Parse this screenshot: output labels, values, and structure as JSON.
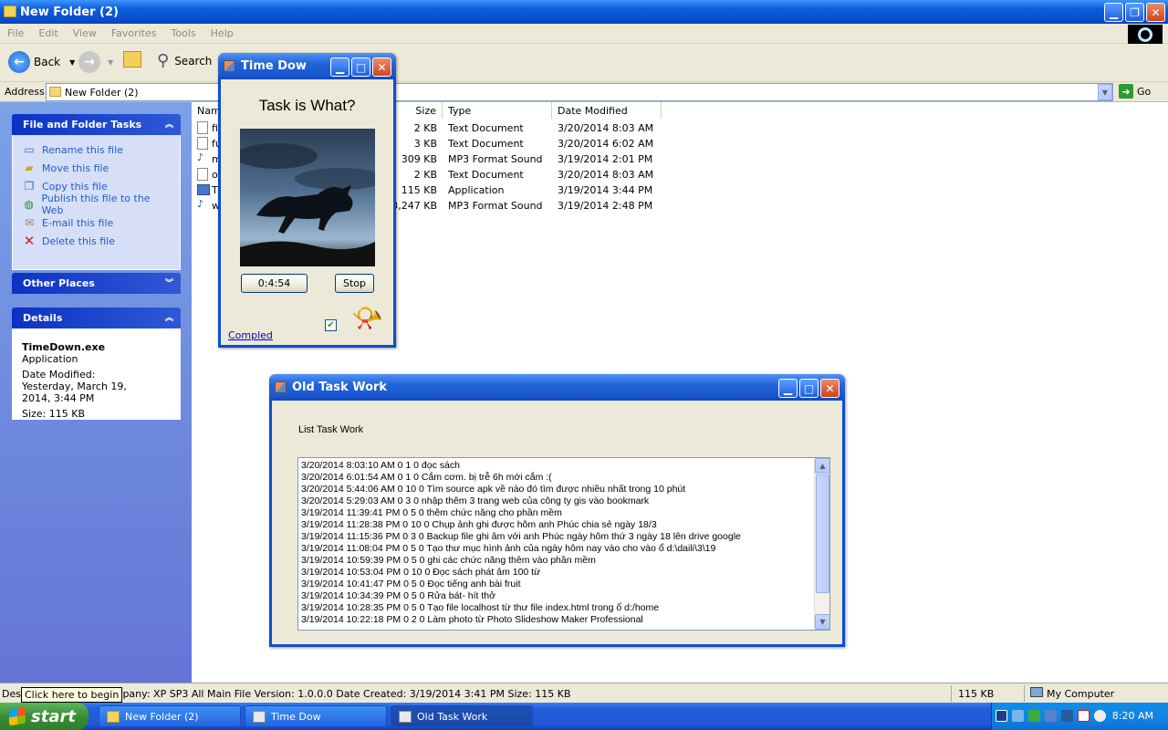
{
  "window": {
    "title": "New Folder (2)",
    "menu": [
      "File",
      "Edit",
      "View",
      "Favorites",
      "Tools",
      "Help"
    ],
    "toolbar": {
      "back_label": "Back",
      "search_label": "Search"
    },
    "address": {
      "label": "Address",
      "value": "New Folder (2)",
      "go_label": "Go"
    }
  },
  "leftpane": {
    "file_tasks": {
      "title": "File and Folder Tasks",
      "items": [
        {
          "label": "Rename this file",
          "icon": "rename-icon"
        },
        {
          "label": "Move this file",
          "icon": "move-icon"
        },
        {
          "label": "Copy this file",
          "icon": "copy-icon"
        },
        {
          "label": "Publish this file to the Web",
          "icon": "publish-icon"
        },
        {
          "label": "E-mail this file",
          "icon": "email-icon"
        },
        {
          "label": "Delete this file",
          "icon": "delete-icon"
        }
      ]
    },
    "other_places": {
      "title": "Other Places"
    },
    "details": {
      "title": "Details",
      "filename": "TimeDown.exe",
      "type": "Application",
      "date_modified": "Date Modified: Yesterday, March 19, 2014, 3:44 PM",
      "size": "Size: 115 KB"
    }
  },
  "filelist": {
    "columns": [
      "Name",
      "Size",
      "Type",
      "Date Modified"
    ],
    "rows": [
      {
        "name": "fil",
        "size": "2 KB",
        "type": "Text Document",
        "date": "3/20/2014 8:03 AM",
        "icon": "text-file-icon"
      },
      {
        "name": "fu",
        "size": "3 KB",
        "type": "Text Document",
        "date": "3/20/2014 6:02 AM",
        "icon": "text-file-icon"
      },
      {
        "name": "m",
        "size": "309 KB",
        "type": "MP3 Format Sound",
        "date": "3/19/2014 2:01 PM",
        "icon": "audio-file-icon"
      },
      {
        "name": "ol",
        "size": "2 KB",
        "type": "Text Document",
        "date": "3/20/2014 8:03 AM",
        "icon": "text-file-icon"
      },
      {
        "name": "Ti",
        "size": "115 KB",
        "type": "Application",
        "date": "3/19/2014 3:44 PM",
        "icon": "application-icon"
      },
      {
        "name": "w",
        "size": "3,247 KB",
        "type": "MP3 Format Sound",
        "date": "3/19/2014 2:48 PM",
        "icon": "audio-file-icon"
      }
    ]
  },
  "statusbar": {
    "left_prefix": "Desc",
    "text": "ompany: XP SP3 All Main File Version: 1.0.0.0 Date Created: 3/19/2014 3:41 PM Size: 115 KB",
    "size": "115 KB",
    "zone": "My Computer",
    "tooltip": "Click here to begin"
  },
  "timedow": {
    "title": "Time Dow",
    "heading": "Task is What?",
    "timer": "0:4:54",
    "stop_label": "Stop",
    "link": "Compled",
    "checkbox_checked": true
  },
  "oldtask": {
    "title": "Old Task Work",
    "label": "List Task Work",
    "lines": [
      "3/20/2014 8:03:10 AM 0 1 0 đọc sách",
      "3/20/2014 6:01:54 AM 0 1 0 Cắm cơm. bị trễ 6h mới cắm :(",
      "3/20/2014 5:44:06 AM 0 10 0 Tìm source apk về nào đó tìm được nhiều nhất trong 10 phút",
      "3/20/2014 5:29:03 AM 0 3 0 nhập thêm 3 trang web của công ty gis vào bookmark",
      "3/19/2014 11:39:41 PM 0 5 0 thêm chức năng cho phần mềm",
      "3/19/2014 11:28:38 PM 0 10 0 Chụp ảnh ghi được hôm  anh Phúc chia sẻ ngày 18/3",
      "3/19/2014 11:15:36 PM 0 3 0 Backup file ghi âm với anh  Phúc ngày hôm thứ 3 ngày 18 lên drive google",
      "3/19/2014 11:08:04 PM 0 5 0 Tạo thư mục hình ảnh của ngày hôm nay vào cho vào ổ d:\\daili\\3\\19",
      "3/19/2014 10:59:39 PM 0 5 0 ghi các chức năng thêm vào phần mềm",
      "3/19/2014 10:53:04 PM 0 10 0 Đọc sách phát âm 100 từ",
      "3/19/2014 10:41:47 PM 0 5 0 Đọc tiếng anh bài fruit",
      "3/19/2014 10:34:39 PM 0 5 0 Rửa bát- hít thở",
      "3/19/2014 10:28:35 PM 0 5 0 Tạo file localhost từ thư file index.html trong ổ d:/home",
      "3/19/2014 10:22:18 PM 0 2 0 Làm photo từ Photo Slideshow Maker Professional"
    ]
  },
  "taskbar": {
    "start_label": "start",
    "items": [
      "New Folder (2)",
      "Time Dow",
      "Old Task Work"
    ],
    "clock": "8:20 AM"
  }
}
